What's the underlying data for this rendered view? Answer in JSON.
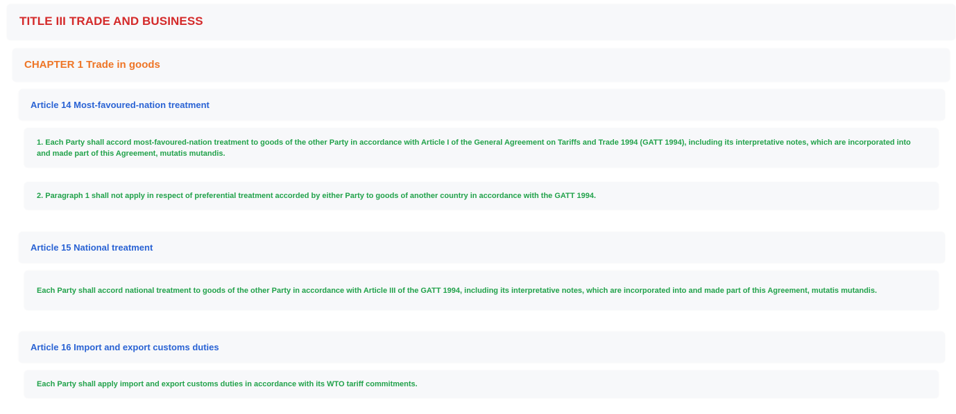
{
  "title": {
    "text": "TITLE III TRADE AND BUSINESS"
  },
  "chapter": {
    "text": "CHAPTER 1 Trade in goods"
  },
  "articles": [
    {
      "heading": "Article 14 Most-favoured-nation treatment",
      "paragraphs": [
        "1. Each Party shall accord most-favoured-nation treatment to goods of the other Party in accordance with Article I of the General Agreement on Tariffs and Trade 1994 (GATT 1994), including its interpretative notes, which are incorporated into and made part of this Agreement, mutatis mutandis.",
        "2. Paragraph 1 shall not apply in respect of preferential treatment accorded by either Party to goods of another country in accordance with the GATT 1994."
      ]
    },
    {
      "heading": "Article 15 National treatment",
      "paragraphs": [
        "Each Party shall accord national treatment to goods of the other Party in accordance with Article III of the GATT 1994, including its interpretative notes, which are incorporated into and made part of this Agreement, mutatis mutandis."
      ]
    },
    {
      "heading": "Article 16 Import and export customs duties",
      "paragraphs": [
        "Each Party shall apply import and export customs duties in accordance with its WTO tariff commitments."
      ]
    }
  ],
  "colors": {
    "title": "#d42a2a",
    "chapter": "#ee7526",
    "article": "#2a63d4",
    "paragraph": "#22a24b",
    "box_background": "#f7f8fa"
  }
}
